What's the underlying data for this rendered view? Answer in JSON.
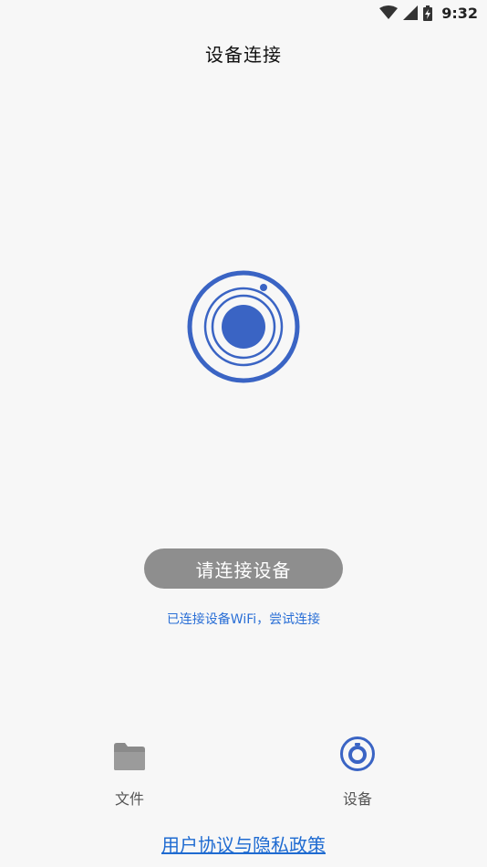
{
  "status_bar": {
    "time": "9:32",
    "icons": [
      "wifi-icon",
      "cell-signal-icon",
      "battery-charging-icon"
    ]
  },
  "header": {
    "title": "设备连接"
  },
  "main": {
    "graphic_icon": "device-lens-icon",
    "connect_button_label": "请连接设备",
    "wifi_link_text": "已连接设备WiFi，尝试连接"
  },
  "bottom_nav": {
    "items": [
      {
        "label": "文件",
        "icon": "folder-icon"
      },
      {
        "label": "设备",
        "icon": "device-icon"
      }
    ]
  },
  "footer": {
    "policy_link": "用户协议与隐私政策"
  },
  "colors": {
    "accent": "#3a64c4",
    "button_bg": "#8e8e8e",
    "link": "#2a6fd6",
    "background": "#f7f7f7"
  }
}
